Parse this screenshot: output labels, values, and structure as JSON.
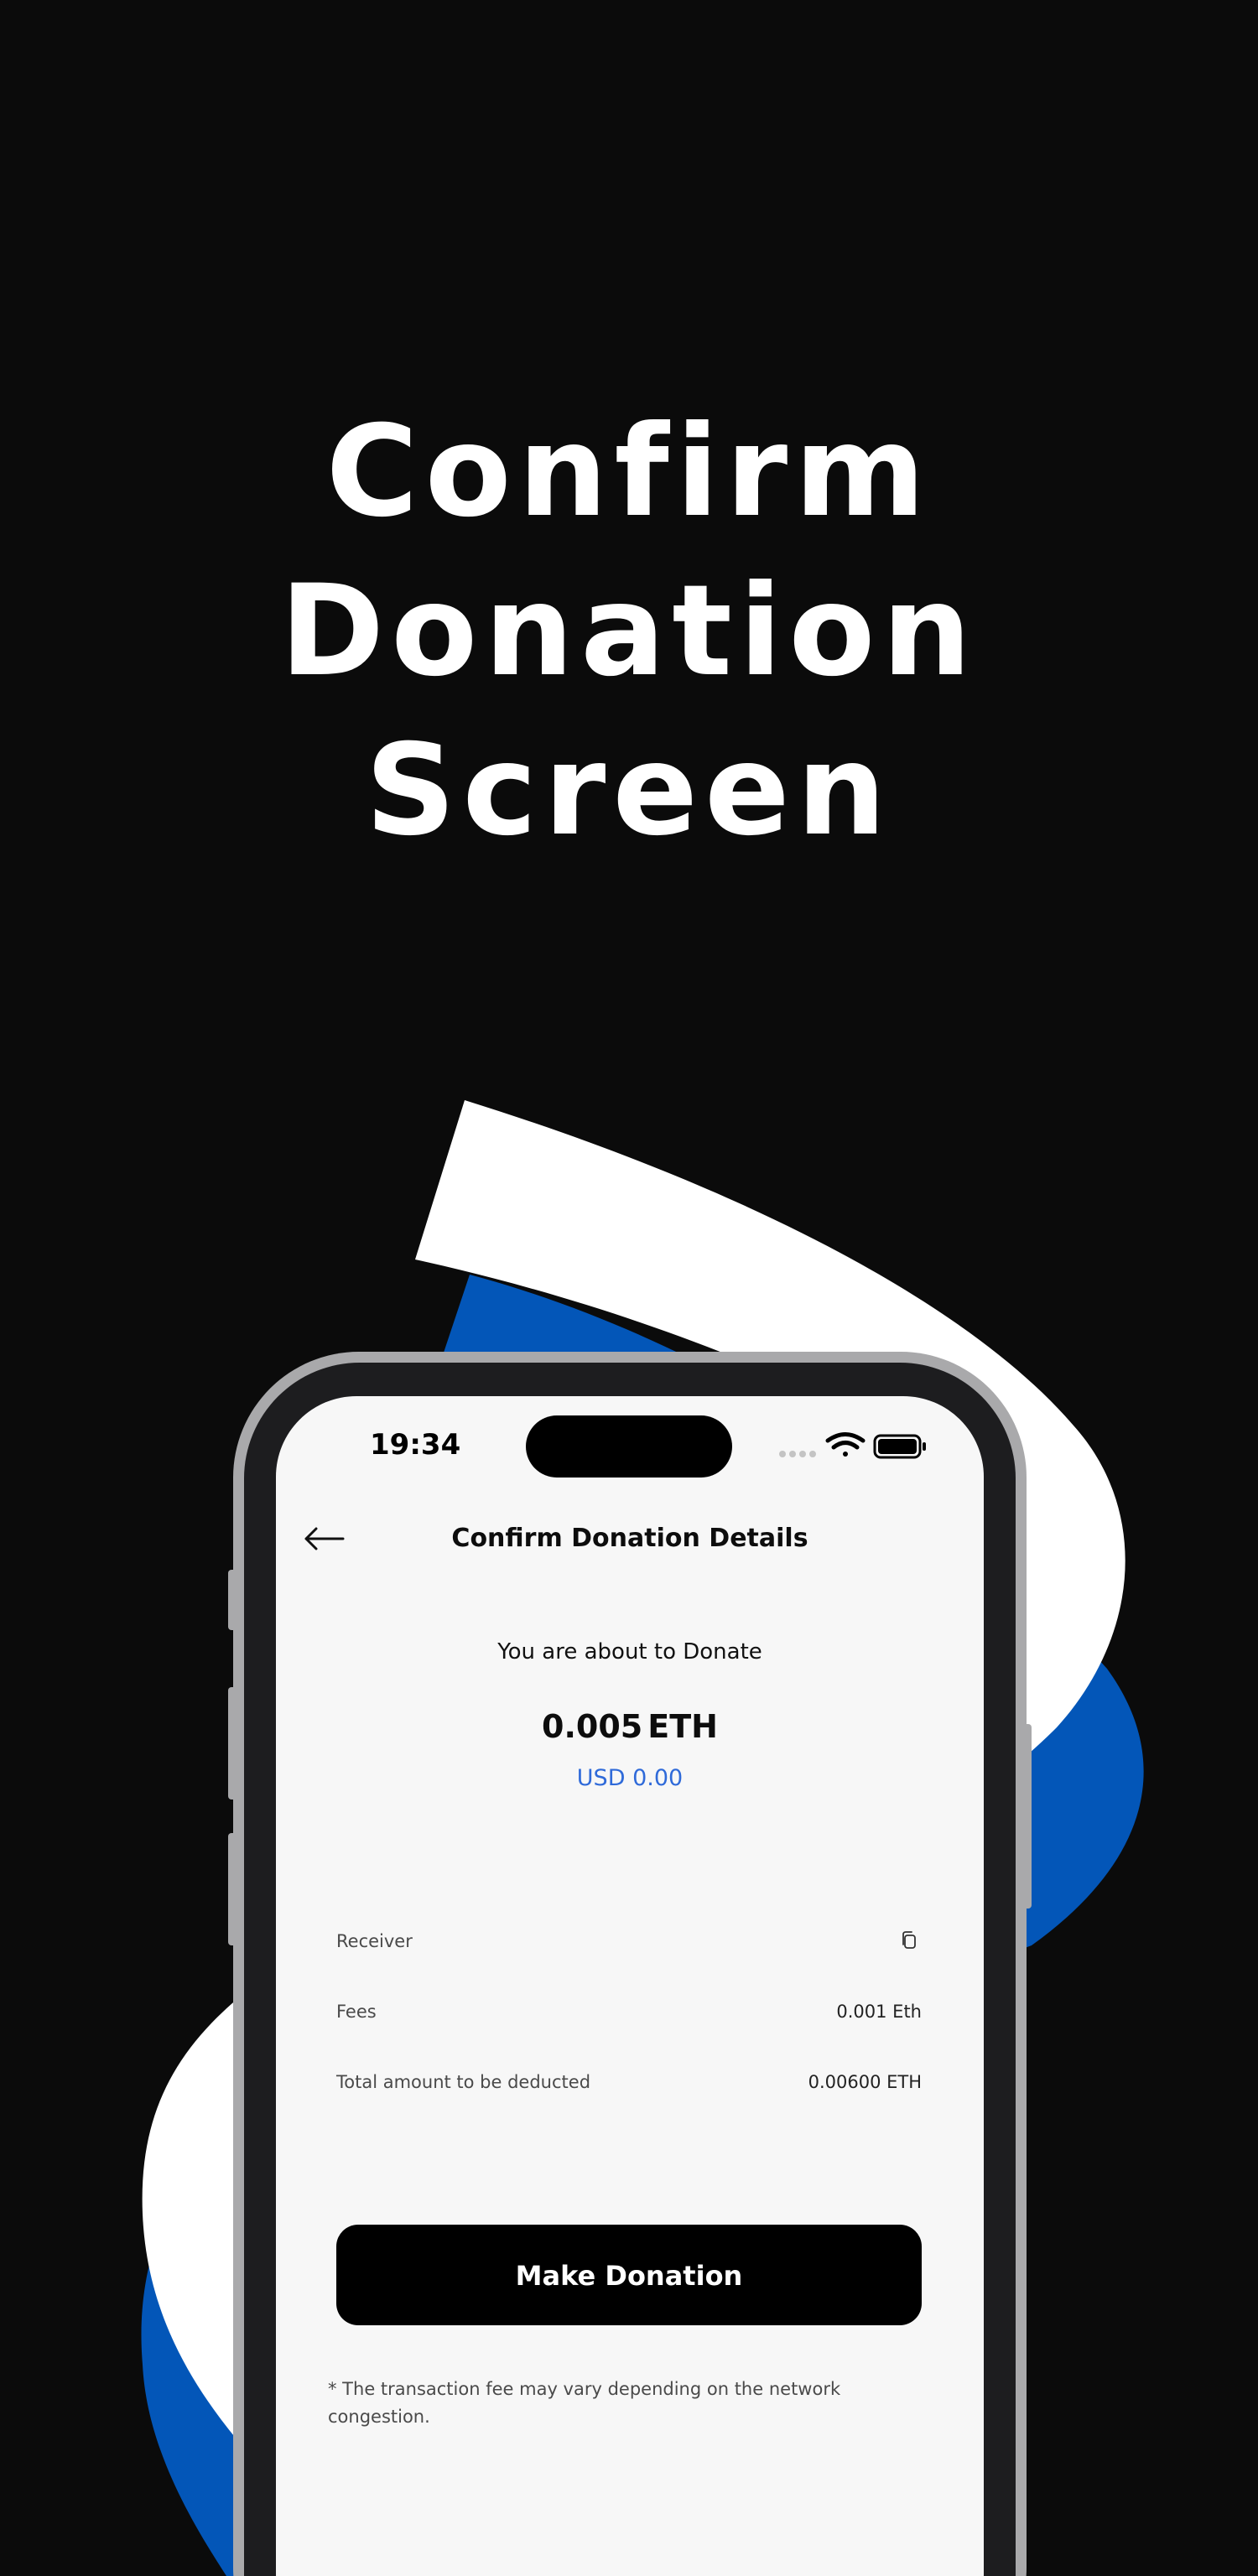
{
  "hero": {
    "line1": "Confirm",
    "line2": "Donation",
    "line3": "Screen"
  },
  "status_bar": {
    "time": "19:34",
    "icons": [
      "cellular-dots-icon",
      "wifi-icon",
      "battery-icon"
    ]
  },
  "header": {
    "title": "Confirm Donation Details",
    "back_icon": "arrow-left-icon"
  },
  "summary": {
    "intro": "You are about to Donate",
    "amount": "0.005",
    "unit": "ETH",
    "usd": "USD 0.00"
  },
  "details": {
    "receiver_label": "Receiver",
    "receiver_icon": "copy-icon",
    "fees_label": "Fees",
    "fees_value": "0.001 Eth",
    "total_label": "Total amount to be deducted",
    "total_value": "0.00600 ETH"
  },
  "cta": {
    "label": "Make Donation"
  },
  "footnote": "* The transaction fee may vary depending on the network congestion.",
  "colors": {
    "background": "#0b0b0b",
    "ribbon_white": "#ffffff",
    "ribbon_blue": "#0356b8",
    "accent_text": "#2f6ad9",
    "button": "#000000",
    "screen": "#f7f7f7"
  }
}
